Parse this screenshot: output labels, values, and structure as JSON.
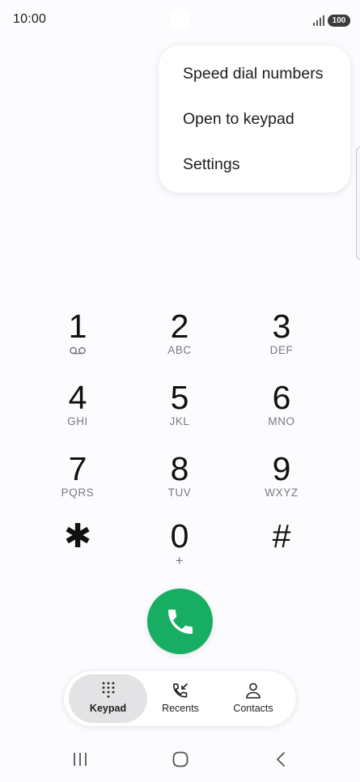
{
  "status": {
    "time": "10:00",
    "battery": "100"
  },
  "menu": {
    "items": [
      {
        "label": "Speed dial numbers"
      },
      {
        "label": "Open to keypad"
      },
      {
        "label": "Settings"
      }
    ]
  },
  "keypad": {
    "keys": [
      {
        "digit": "1",
        "letters": "",
        "icon": "voicemail-icon"
      },
      {
        "digit": "2",
        "letters": "ABC"
      },
      {
        "digit": "3",
        "letters": "DEF"
      },
      {
        "digit": "4",
        "letters": "GHI"
      },
      {
        "digit": "5",
        "letters": "JKL"
      },
      {
        "digit": "6",
        "letters": "MNO"
      },
      {
        "digit": "7",
        "letters": "PQRS"
      },
      {
        "digit": "8",
        "letters": "TUV"
      },
      {
        "digit": "9",
        "letters": "WXYZ"
      },
      {
        "digit": "✱",
        "letters": ""
      },
      {
        "digit": "0",
        "letters": "+"
      },
      {
        "digit": "#",
        "letters": ""
      }
    ]
  },
  "call": {
    "icon": "phone-icon",
    "color": "#17ad63"
  },
  "tabs": [
    {
      "label": "Keypad",
      "icon": "keypad-icon",
      "active": true
    },
    {
      "label": "Recents",
      "icon": "recents-icon",
      "active": false
    },
    {
      "label": "Contacts",
      "icon": "contacts-icon",
      "active": false
    }
  ],
  "navigation": {
    "buttons": [
      "recent-apps-icon",
      "home-icon",
      "back-icon"
    ]
  }
}
